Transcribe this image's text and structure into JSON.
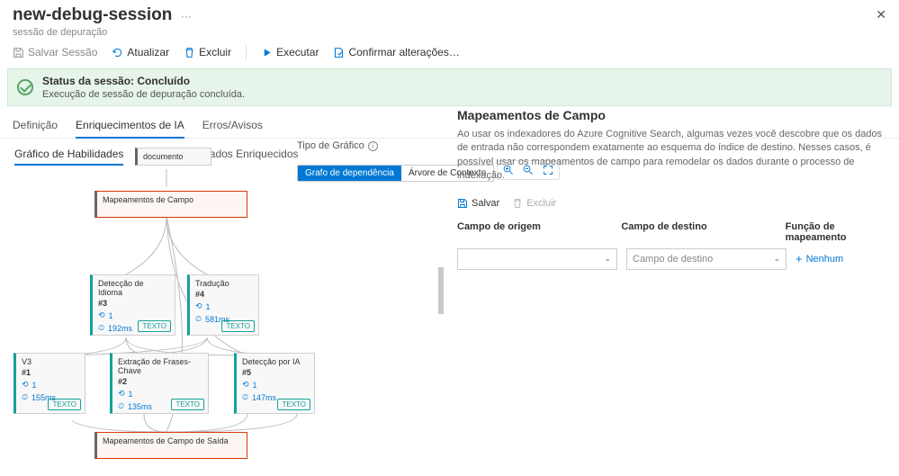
{
  "header": {
    "title": "new-debug-session",
    "subtitle": "sessão de depuração"
  },
  "toolbar": {
    "save": "Salvar Sessão",
    "refresh": "Atualizar",
    "delete": "Excluir",
    "run": "Executar",
    "confirm": "Confirmar alterações…"
  },
  "banner": {
    "title": "Status da sessão: Concluído",
    "msg": "Execução de sessão de depuração concluída."
  },
  "tabs": {
    "def": "Definição",
    "enrich": "Enriquecimentos de IA",
    "err": "Erros/Avisos"
  },
  "subtabs": {
    "skill": "Gráfico de Habilidades",
    "struct": "Estrutura de Dados Enriquecidos"
  },
  "graphCtrl": {
    "label": "Tipo de Gráfico",
    "opt1": "Grafo de dependência",
    "opt2": "Árvore de Contexto"
  },
  "nodes": {
    "doc": "documento",
    "fm": "Mapeamentos de Campo",
    "lang": {
      "t": "Detecção de Idioma",
      "n": "#3",
      "count": "1",
      "time": "192ms",
      "badge": "TEXTO"
    },
    "trans": {
      "t": "Tradução",
      "n": "#4",
      "count": "1",
      "time": "581ms",
      "badge": "TEXTO"
    },
    "v3": {
      "t": "V3",
      "n": "#1",
      "count": "1",
      "time": "155ms",
      "badge": "TEXTO"
    },
    "key": {
      "t": "Extração de Frases-Chave",
      "n": "#2",
      "count": "1",
      "time": "135ms",
      "badge": "TEXTO"
    },
    "ai": {
      "t": "Detecção por IA",
      "n": "#5",
      "count": "1",
      "time": "147ms",
      "badge": "TEXTO"
    },
    "out": "Mapeamentos de Campo de Saída"
  },
  "right": {
    "title": "Mapeamentos de Campo",
    "desc": "Ao usar os indexadores do Azure Cognitive Search, algumas vezes você descobre que os dados de entrada não correspondem exatamente ao esquema do índice de destino. Nesses casos, é possível usar os mapeamentos de campo para remodelar os dados durante o processo de indexação.",
    "save": "Salvar",
    "delete": "Excluir",
    "col1": "Campo de origem",
    "col2": "Campo de destino",
    "col3": "Função de mapeamento",
    "dd2": "Campo de destino",
    "add": "Nenhum"
  }
}
